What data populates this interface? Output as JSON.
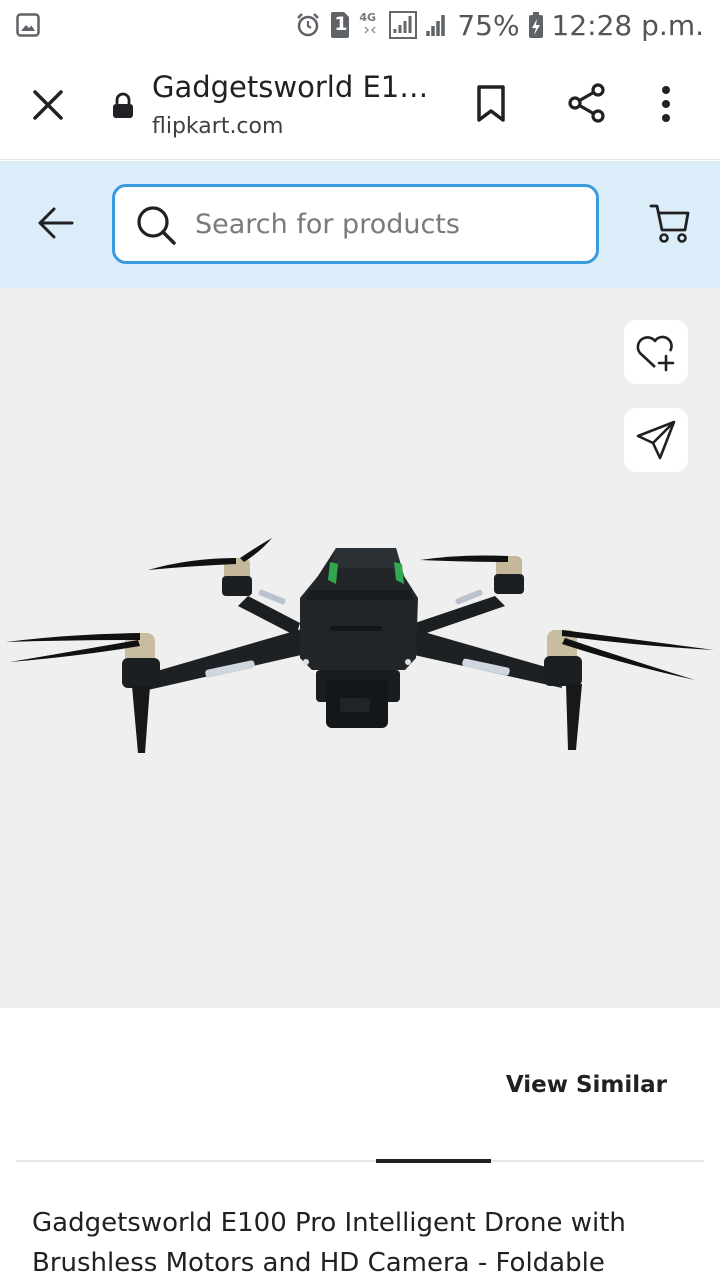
{
  "status_bar": {
    "battery": "75%",
    "time": "12:28 p.m.",
    "sim_slot": "1",
    "network": "4G",
    "icons": [
      "gallery-icon",
      "alarm-icon",
      "sim-icon",
      "signal-icon",
      "battery-charging-icon"
    ]
  },
  "browser": {
    "title": "Gadgetsworld E1…",
    "url": "flipkart.com",
    "icons": [
      "close-icon",
      "lock-icon",
      "bookmark-icon",
      "share-icon",
      "overflow-menu-icon"
    ]
  },
  "search": {
    "placeholder": "Search for products",
    "value": "",
    "icons": [
      "back-arrow-icon",
      "search-icon",
      "cart-icon"
    ],
    "accent": "#3a9ae0",
    "background": "#dcedfa"
  },
  "gallery": {
    "icons": [
      "wishlist-heart-icon",
      "share-send-icon"
    ],
    "background": "#efefef"
  },
  "product": {
    "view_similar_label": "View Similar",
    "title": "Gadgetsworld E100 Pro Intelligent Drone with Brushless Motors and HD Camera - Foldable"
  }
}
